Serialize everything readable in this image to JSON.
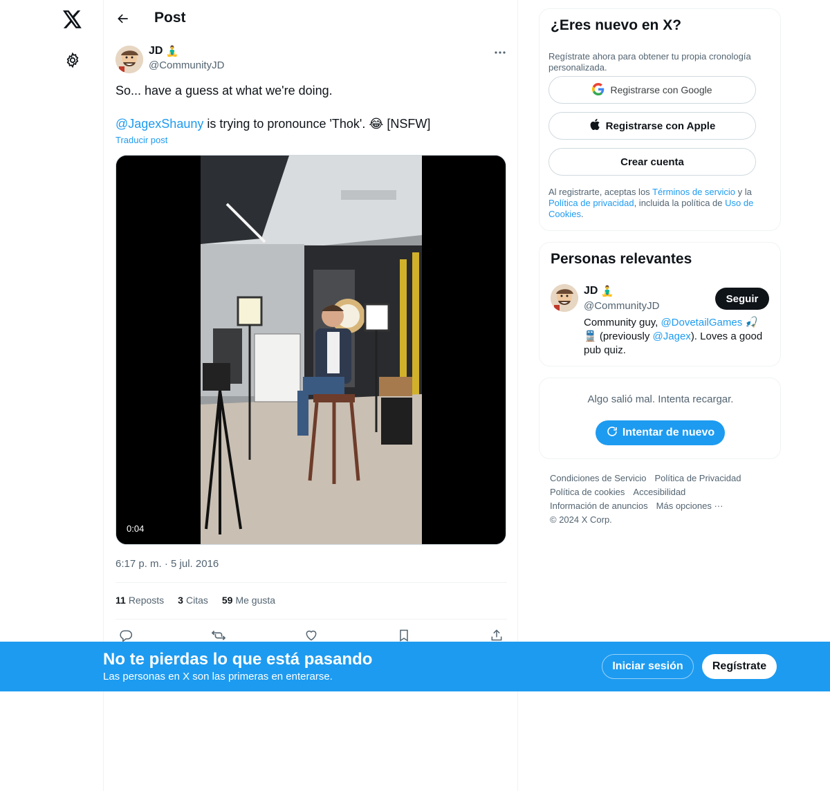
{
  "nav": {
    "logo_icon": "x-logo-icon",
    "settings_icon": "gear-icon"
  },
  "header": {
    "back_icon": "arrow-left-icon",
    "title": "Post"
  },
  "post": {
    "author_name": "JD",
    "author_emoji": "🧘‍♂",
    "author_handle": "@CommunityJD",
    "text_line1": "So... have a guess at what we're doing.",
    "mention": "@JagexShauny",
    "text_line2_rest": " is trying to pronounce 'Thok'. 😂 [NSFW]",
    "translate_label": "Traducir post",
    "video_duration": "0:04",
    "timestamp": "6:17 p. m. · 5 jul. 2016",
    "stats": [
      {
        "count": "11",
        "label": "Reposts"
      },
      {
        "count": "3",
        "label": "Citas"
      },
      {
        "count": "59",
        "label": "Me gusta"
      }
    ],
    "actions": [
      "reply-icon",
      "repost-icon",
      "like-icon",
      "bookmark-icon",
      "share-icon"
    ]
  },
  "signup": {
    "title": "¿Eres nuevo en X?",
    "subtitle": "Regístrate ahora para obtener tu propia cronología personalizada.",
    "google_label": "Registrarse con Google",
    "apple_label": "Registrarse con Apple",
    "create_label": "Crear cuenta",
    "legal_prefix": "Al registrarte, aceptas los ",
    "legal_terms": "Términos de servicio",
    "legal_mid1": " y la ",
    "legal_privacy": "Política de privacidad",
    "legal_mid2": ", incluida la política de ",
    "legal_cookies": "Uso de Cookies",
    "legal_suffix": "."
  },
  "relevant": {
    "title": "Personas relevantes",
    "name": "JD",
    "emoji": "🧘‍♂",
    "handle": "@CommunityJD",
    "follow_label": "Seguir",
    "bio_prefix": "Community guy, ",
    "bio_link1": "@DovetailGames",
    "bio_mid": " 🎣🚆 (previously ",
    "bio_link2": "@Jagex",
    "bio_suffix": "). Loves a good pub quiz."
  },
  "error": {
    "message": "Algo salió mal. Intenta recargar.",
    "retry_label": "Intentar de nuevo"
  },
  "footer": {
    "links_row1": [
      "Condiciones de Servicio",
      "Política de Privacidad"
    ],
    "links_row2": [
      "Política de cookies",
      "Accesibilidad"
    ],
    "links_row3": [
      "Información de anuncios",
      "Más opciones ···"
    ],
    "copyright": "© 2024 X Corp."
  },
  "banner": {
    "title": "No te pierdas lo que está pasando",
    "subtitle": "Las personas en X son las primeras en enterarse.",
    "login_label": "Iniciar sesión",
    "register_label": "Regístrate"
  },
  "colors": {
    "accent": "#1d9bf0",
    "text": "#0f1419",
    "muted": "#536471"
  }
}
